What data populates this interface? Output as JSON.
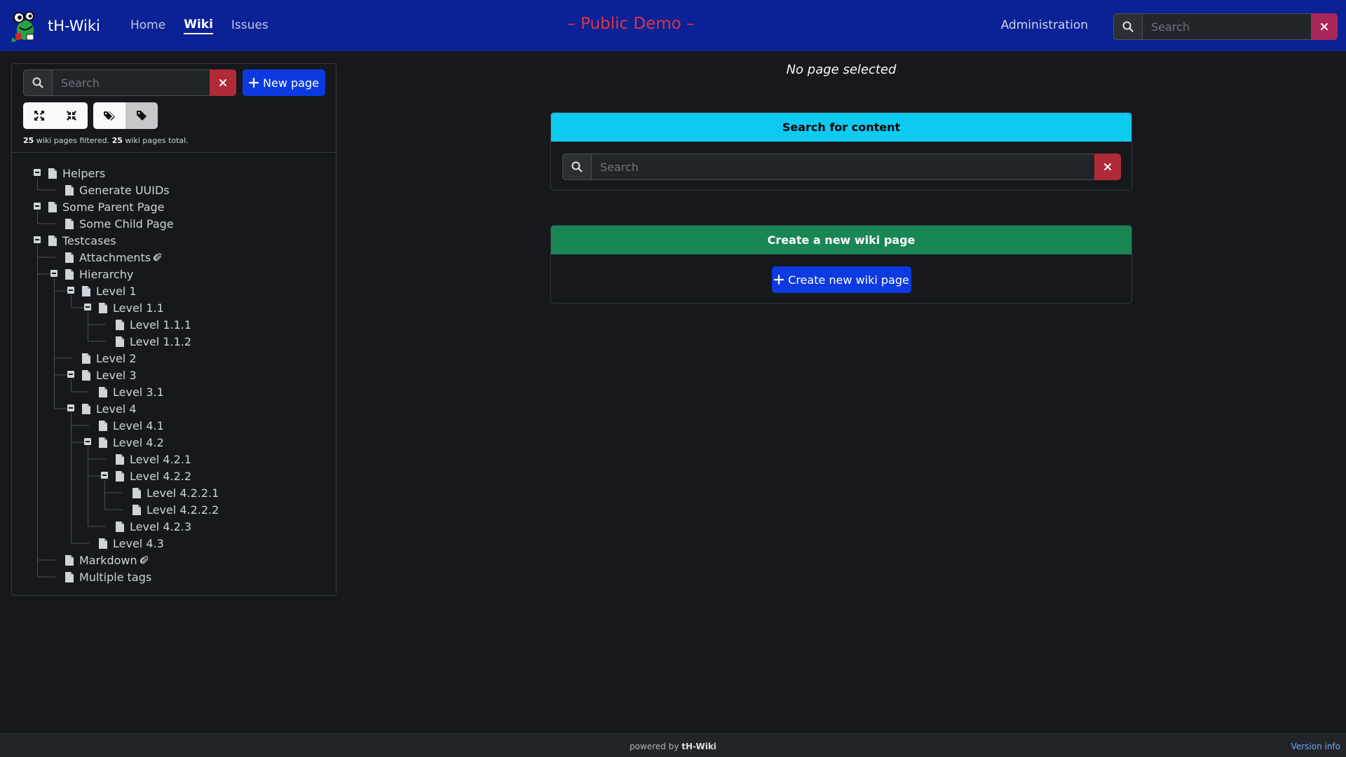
{
  "navbar": {
    "brand": "tH-Wiki",
    "links": [
      {
        "label": "Home",
        "active": false
      },
      {
        "label": "Wiki",
        "active": true
      },
      {
        "label": "Issues",
        "active": false
      }
    ],
    "demo_title": "– Public Demo –",
    "admin_label": "Administration",
    "search_placeholder": "Search"
  },
  "sidebar": {
    "search_placeholder": "Search",
    "new_page_label": "New page",
    "filtered_count": "25",
    "filtered_text": " wiki pages filtered. ",
    "total_count": "25",
    "total_text": " wiki pages total.",
    "tree": [
      {
        "label": "Helpers",
        "depth": 0,
        "expanded": true
      },
      {
        "label": "Generate UUIDs",
        "depth": 1
      },
      {
        "label": "Some Parent Page",
        "depth": 0,
        "expanded": true
      },
      {
        "label": "Some Child Page",
        "depth": 1
      },
      {
        "label": "Testcases",
        "depth": 0,
        "expanded": true
      },
      {
        "label": "Attachments",
        "depth": 1,
        "attachment": true
      },
      {
        "label": "Hierarchy",
        "depth": 1,
        "expanded": true
      },
      {
        "label": "Level 1",
        "depth": 2,
        "expanded": true
      },
      {
        "label": "Level 1.1",
        "depth": 3,
        "expanded": true
      },
      {
        "label": "Level 1.1.1",
        "depth": 4
      },
      {
        "label": "Level 1.1.2",
        "depth": 4
      },
      {
        "label": "Level 2",
        "depth": 2
      },
      {
        "label": "Level 3",
        "depth": 2,
        "expanded": true
      },
      {
        "label": "Level 3.1",
        "depth": 3
      },
      {
        "label": "Level 4",
        "depth": 2,
        "expanded": true
      },
      {
        "label": "Level 4.1",
        "depth": 3
      },
      {
        "label": "Level 4.2",
        "depth": 3,
        "expanded": true
      },
      {
        "label": "Level 4.2.1",
        "depth": 4
      },
      {
        "label": "Level 4.2.2",
        "depth": 4,
        "expanded": true
      },
      {
        "label": "Level 4.2.2.1",
        "depth": 5
      },
      {
        "label": "Level 4.2.2.2",
        "depth": 5
      },
      {
        "label": "Level 4.2.3",
        "depth": 4
      },
      {
        "label": "Level 4.3",
        "depth": 3
      },
      {
        "label": "Markdown",
        "depth": 1,
        "attachment": true
      },
      {
        "label": "Multiple tags",
        "depth": 1
      }
    ]
  },
  "main": {
    "no_page": "No page selected",
    "search_card_title": "Search for content",
    "search_placeholder": "Search",
    "create_card_title": "Create a new wiki page",
    "create_button_label": "Create new wiki page"
  },
  "footer": {
    "powered_prefix": "powered by ",
    "powered_brand": "tH-Wiki",
    "version_label": "Version info"
  },
  "colors": {
    "navbar": "#0b2196",
    "demo_title": "#dc3545",
    "primary_button": "#0d3ae0",
    "clear_button": "#b02a37",
    "search_card_header": "#0dcaf0",
    "create_card_header": "#198754"
  }
}
